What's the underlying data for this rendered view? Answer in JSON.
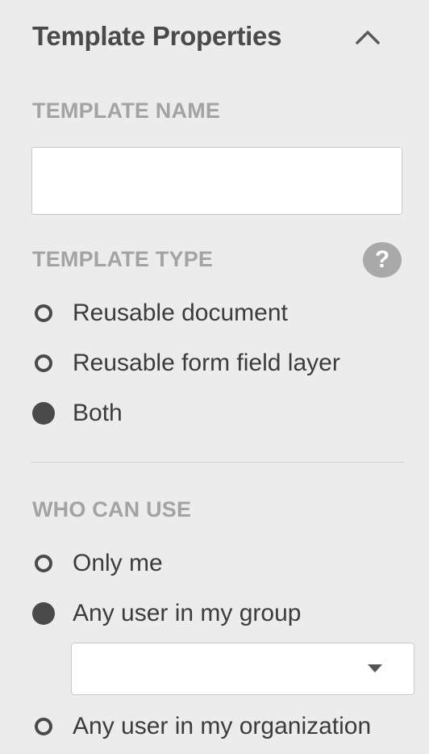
{
  "panel": {
    "title": "Template Properties",
    "collapse_icon": "chevron-up-icon"
  },
  "template_name": {
    "label": "TEMPLATE NAME",
    "value": "",
    "placeholder": ""
  },
  "template_type": {
    "label": "TEMPLATE TYPE",
    "help_glyph": "?",
    "help_icon": "help-icon",
    "options": [
      {
        "label": "Reusable document",
        "checked": false
      },
      {
        "label": "Reusable form field layer",
        "checked": false
      },
      {
        "label": "Both",
        "checked": true
      }
    ]
  },
  "who_can_use": {
    "label": "WHO CAN USE",
    "options": [
      {
        "label": "Only me",
        "checked": false
      },
      {
        "label": "Any user in my group",
        "checked": true
      },
      {
        "label": "Any user in my organization",
        "checked": false
      }
    ],
    "group_select": {
      "value": "",
      "icon": "caret-down-icon"
    }
  },
  "colors": {
    "background": "#ececec",
    "text": "#3c3c3c",
    "section_label": "#a3a3a3",
    "radio": "#4a4a4a",
    "help_icon_bg": "#a9a9a9"
  }
}
